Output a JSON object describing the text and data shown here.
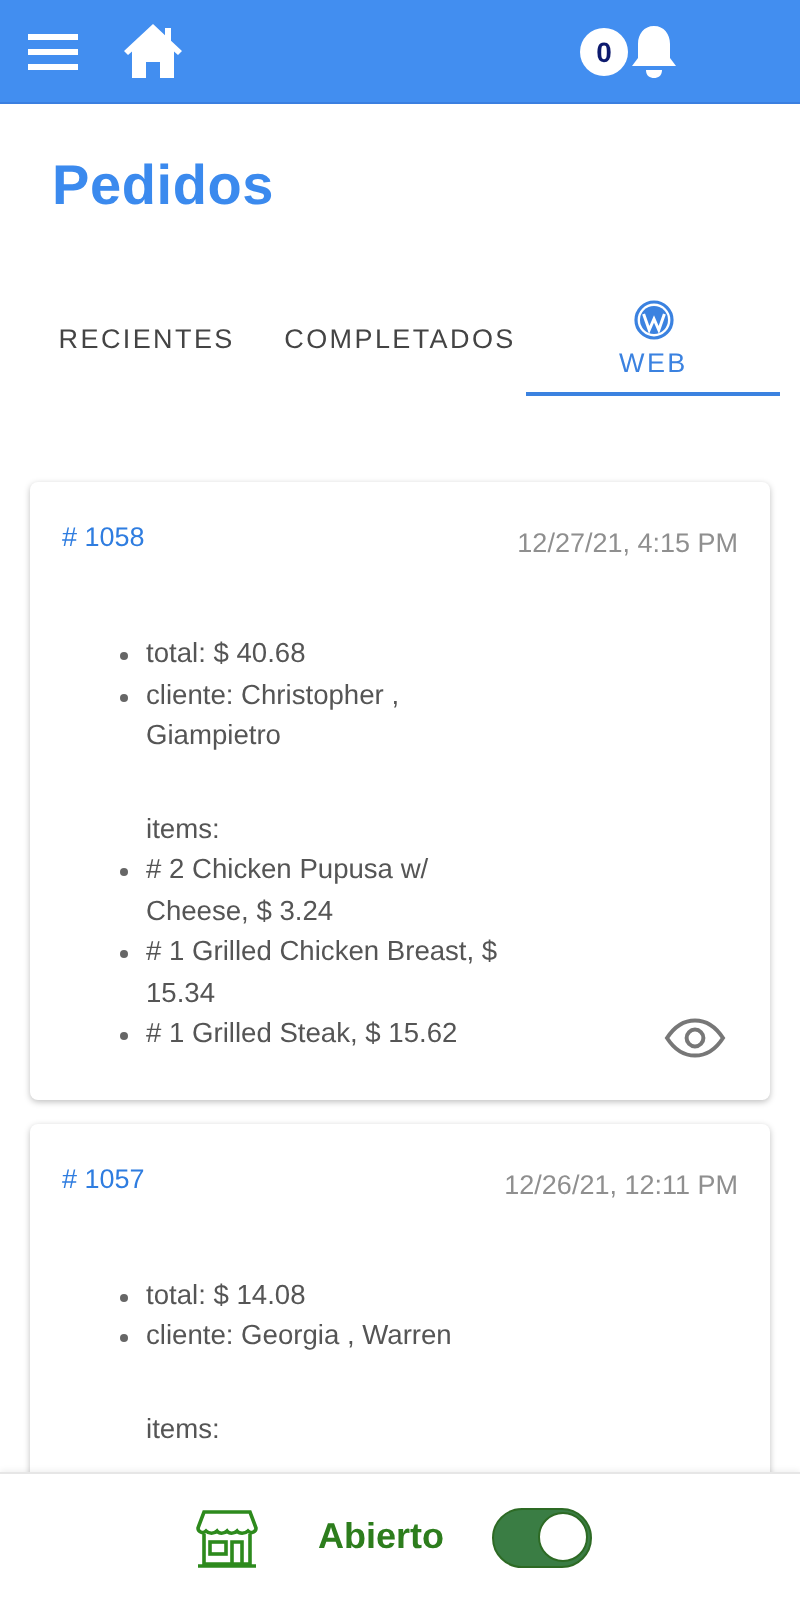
{
  "header": {
    "notification_count": "0"
  },
  "title": "Pedidos",
  "tabs": [
    {
      "label": "RECIENTES",
      "selected": false,
      "icon": false
    },
    {
      "label": "COMPLETADOS",
      "selected": false,
      "icon": false
    },
    {
      "label": "WEB",
      "selected": true,
      "icon": true
    }
  ],
  "orders": [
    {
      "number": "# 1058",
      "date": "12/27/21, 4:15 PM",
      "details": [
        "total: $ 40.68",
        "cliente: Christopher , Giampietro"
      ],
      "items_label": "items:",
      "items": [
        "# 2 Chicken Pupusa w/ Cheese, $ 3.24",
        "# 1 Grilled Chicken Breast, $ 15.34",
        "# 1 Grilled Steak, $ 15.62"
      ],
      "view_icon": true
    },
    {
      "number": "# 1057",
      "date": "12/26/21, 12:11 PM",
      "details": [
        "total: $ 14.08",
        "cliente: Georgia , Warren"
      ],
      "items_label": "items:",
      "view_icon": false
    }
  ],
  "footer": {
    "status": "Abierto",
    "open": true
  }
}
